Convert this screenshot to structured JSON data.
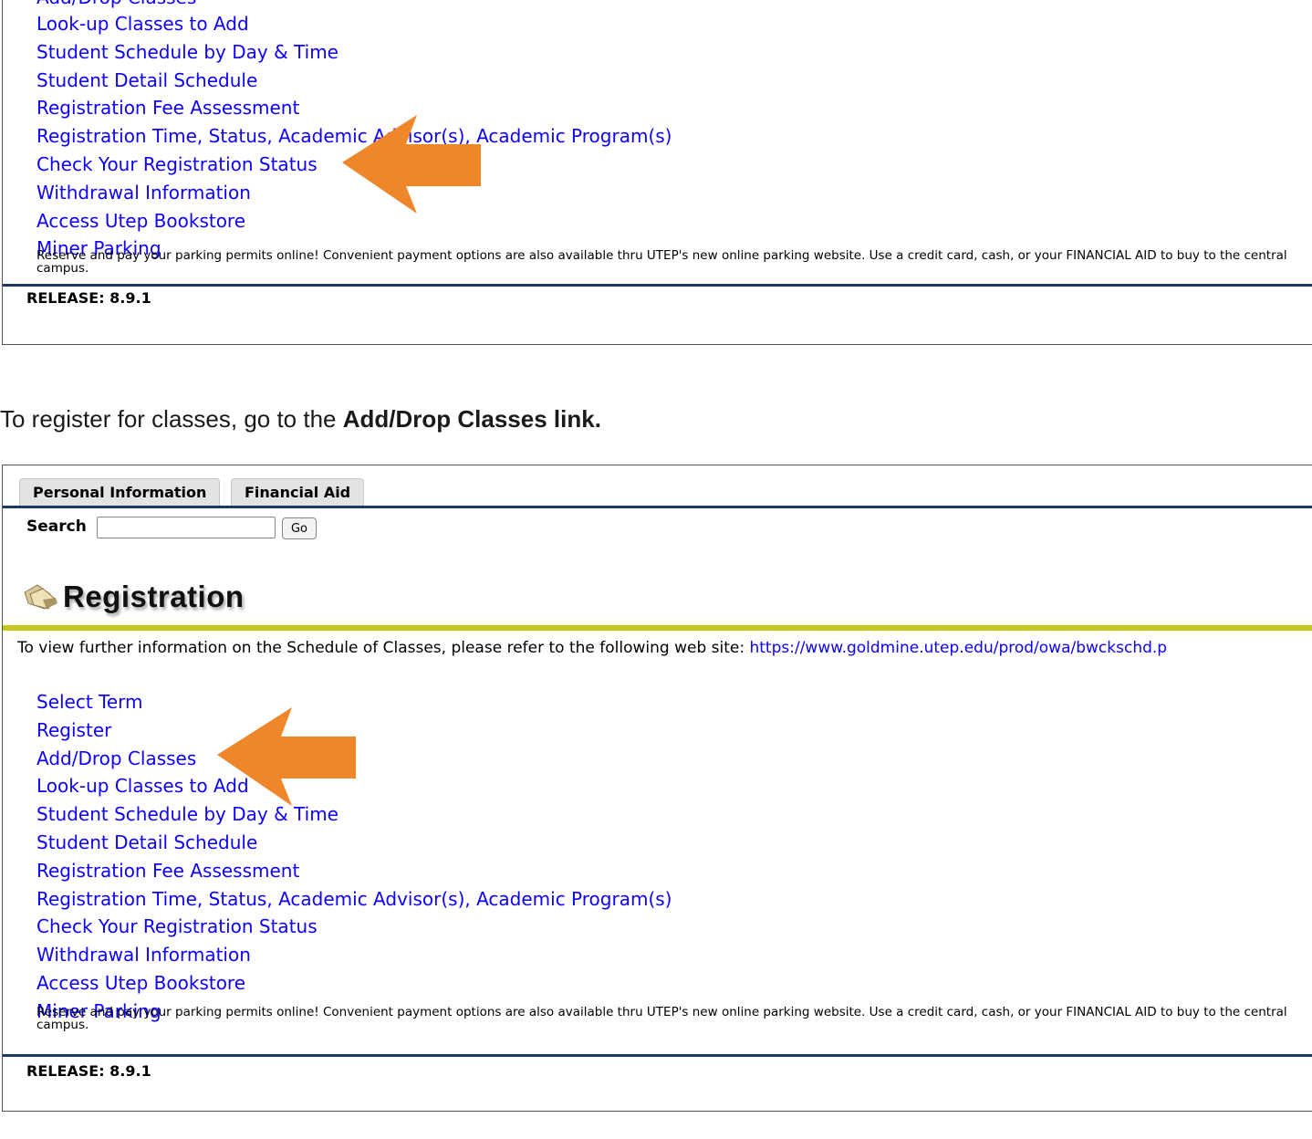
{
  "top_panel": {
    "links": [
      "Add/Drop Classes",
      "Look-up Classes to Add",
      "Student Schedule by Day & Time",
      "Student Detail Schedule",
      "Registration Fee Assessment",
      "Registration Time, Status, Academic Advisor(s), Academic Program(s)",
      "Check Your Registration Status",
      "Withdrawal Information",
      "Access Utep Bookstore",
      "Miner Parking"
    ],
    "parking_note": "Reserve and pay your parking permits online! Convenient payment options are also available thru UTEP's new online parking website. Use a credit card, cash, or your FINANCIAL AID to buy to the central campus.",
    "release": "RELEASE: 8.9.1"
  },
  "caption": {
    "prefix": "To register for classes, go to the ",
    "bold": "Add/Drop Classes link."
  },
  "bottom_panel": {
    "tabs": [
      "Personal Information",
      "Financial Aid"
    ],
    "search": {
      "label": "Search",
      "value": "",
      "placeholder": "",
      "go_label": "Go"
    },
    "heading": "Registration",
    "info_text": "To view further information on the Schedule of Classes, please refer to the following web site: ",
    "info_link": "https://www.goldmine.utep.edu/prod/owa/bwckschd.p",
    "links": [
      "Select Term",
      "Register",
      "Add/Drop Classes",
      "Look-up Classes to Add",
      "Student Schedule by Day & Time",
      "Student Detail Schedule",
      "Registration Fee Assessment",
      "Registration Time, Status, Academic Advisor(s), Academic Program(s)",
      "Check Your Registration Status",
      "Withdrawal Information",
      "Access Utep Bookstore",
      "Miner Parking"
    ],
    "parking_note": "Reserve and pay your parking permits online! Convenient payment options are also available thru UTEP's new online parking website. Use a credit card, cash, or your FINANCIAL AID to buy to the central campus.",
    "release": "RELEASE: 8.9.1"
  },
  "colors": {
    "link": "#0d00ff",
    "arrow": "#ef8629",
    "navy_rule": "#1f3864",
    "yellow_rule": "#c7c91c"
  },
  "icons": {
    "arrow": "arrow-left-icon",
    "folder": "folder-icon"
  }
}
